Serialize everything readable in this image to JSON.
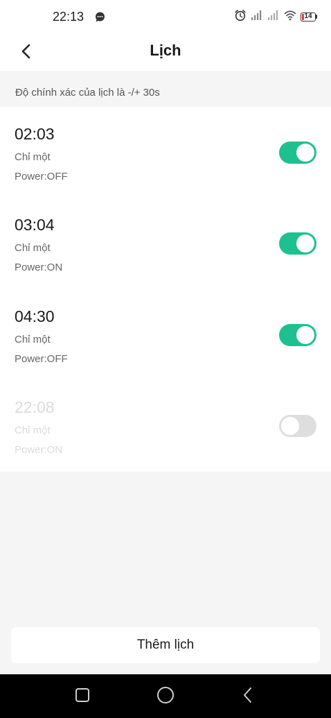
{
  "status_bar": {
    "time": "22:13",
    "battery_level": "14",
    "icons": [
      "message-icon",
      "alarm-icon",
      "signal-icon",
      "signal-icon",
      "wifi-icon",
      "battery-icon"
    ]
  },
  "header": {
    "title": "Lịch",
    "back_icon": "chevron-left-icon"
  },
  "notice": "Độ chính xác của lịch là -/+ 30s",
  "schedules": [
    {
      "time": "02:03",
      "repeat": "Chỉ một",
      "action": "Power:OFF",
      "enabled": true
    },
    {
      "time": "03:04",
      "repeat": "Chỉ một",
      "action": "Power:ON",
      "enabled": true
    },
    {
      "time": "04:30",
      "repeat": "Chỉ một",
      "action": "Power:OFF",
      "enabled": true
    },
    {
      "time": "22:08",
      "repeat": "Chỉ một",
      "action": "Power:ON",
      "enabled": false
    }
  ],
  "add_button_label": "Thêm lịch",
  "colors": {
    "accent": "#1fc08f",
    "toggle_off": "#dedede",
    "background": "#f5f5f5",
    "battery_low": "#e53935"
  },
  "nav_bar": {
    "icons": [
      "recent-apps-icon",
      "home-icon",
      "back-icon"
    ]
  }
}
